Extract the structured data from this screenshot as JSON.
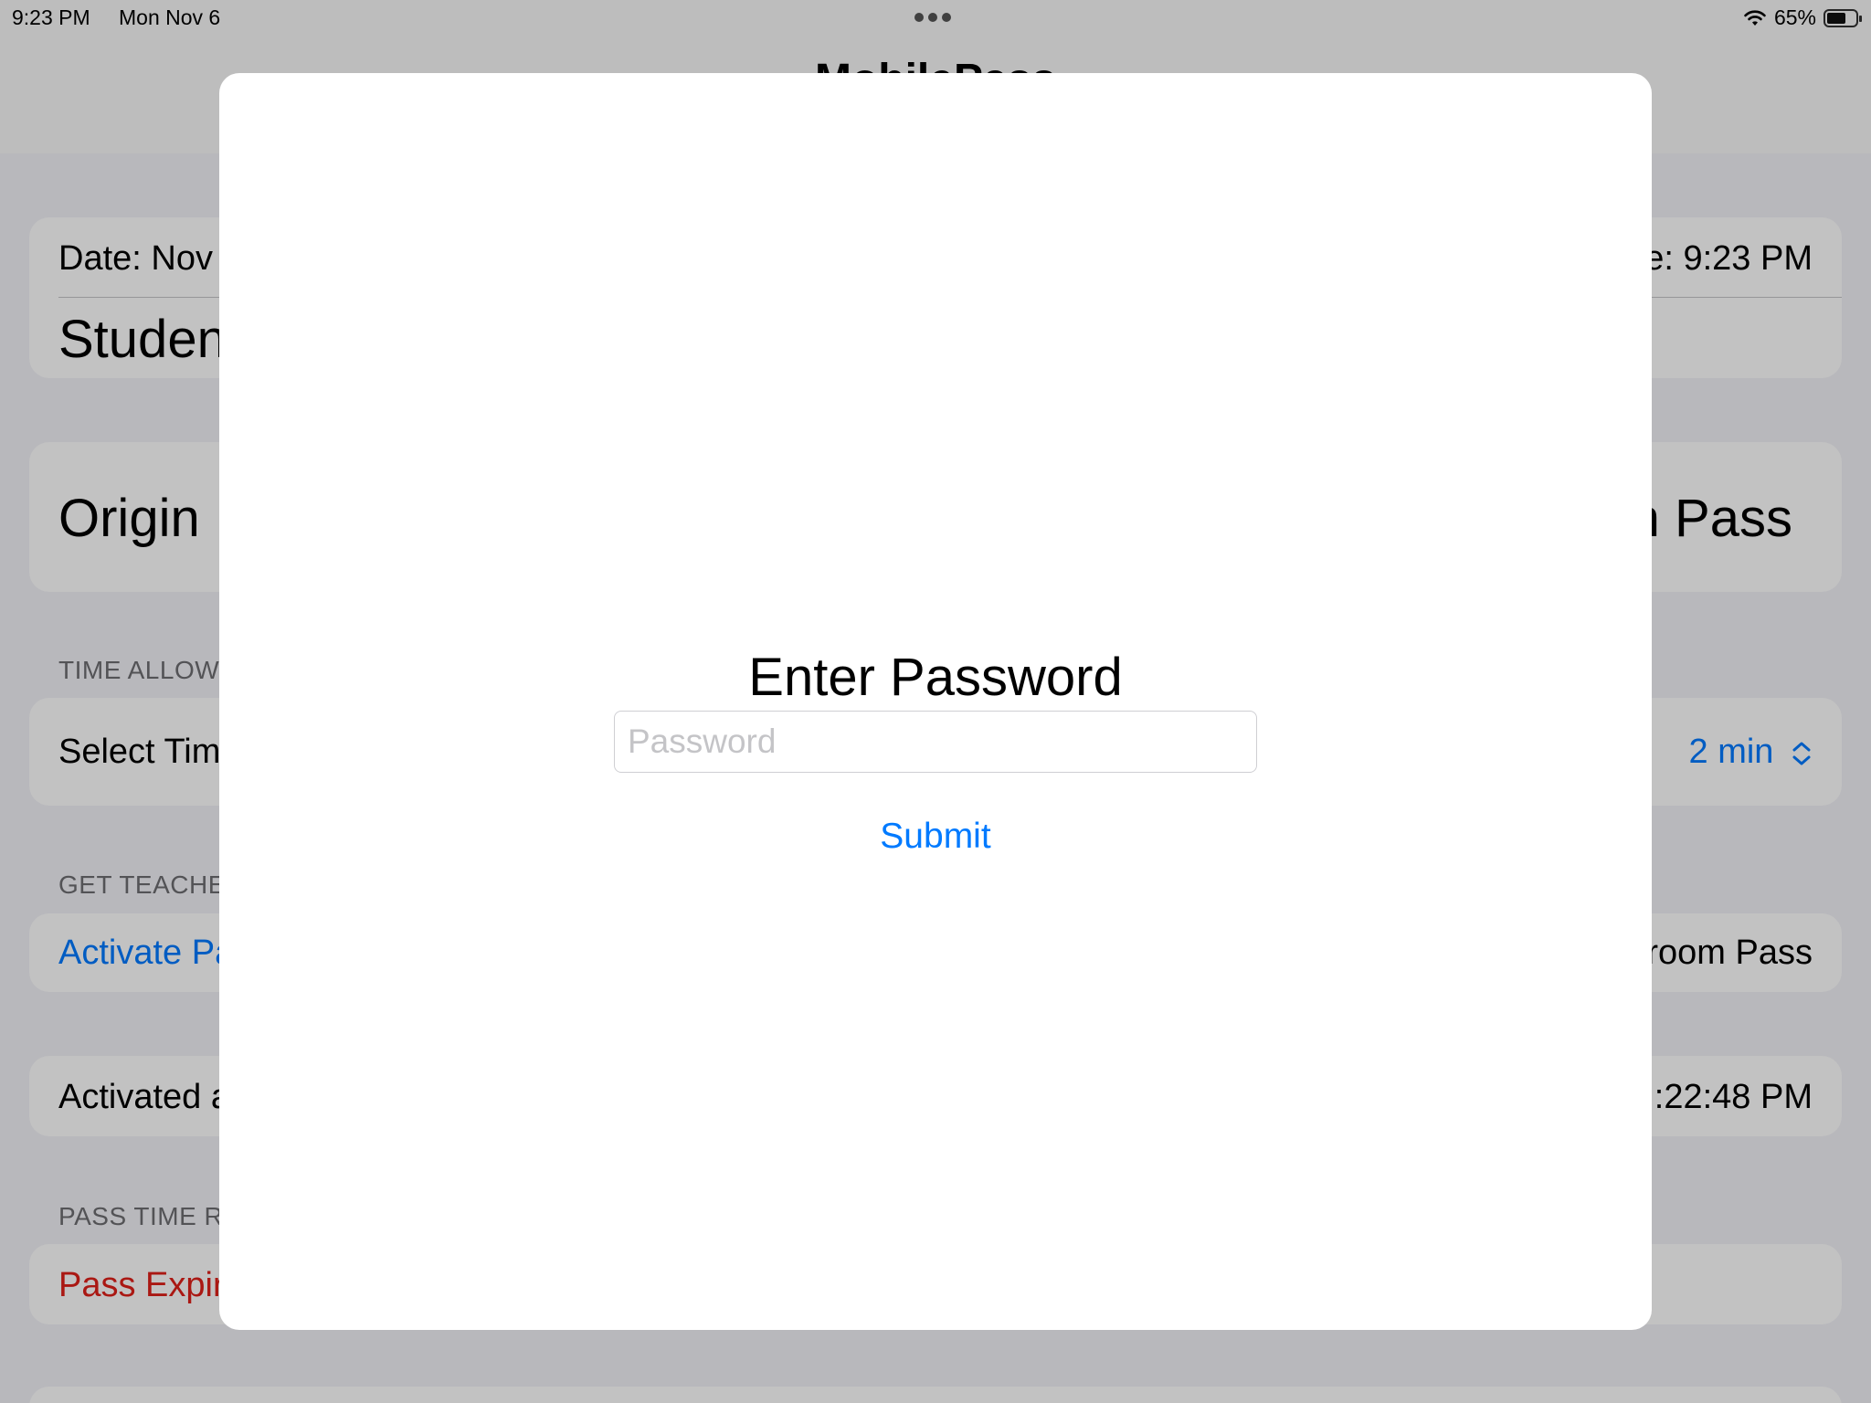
{
  "status_bar": {
    "time": "9:23 PM",
    "date": "Mon Nov 6",
    "battery": "65%",
    "battery_level": 0.65
  },
  "nav": {
    "title": "MobilePass"
  },
  "info_card": {
    "date_label": "Date: Nov",
    "time_label": "e: 9:23 PM",
    "student_label": "Studen"
  },
  "origin_card": {
    "origin_label": "Origin",
    "pass_label": "n Pass"
  },
  "time_allowed": {
    "header": "TIME ALLOW",
    "select_label": "Select Tim",
    "value": "2 min"
  },
  "teacher_section": {
    "header": "GET TEACHE",
    "activate_label": "Activate Pa",
    "pass_type": "room Pass"
  },
  "activated_card": {
    "label": "Activated a",
    "time": ":22:48 PM"
  },
  "pass_time": {
    "header": "PASS TIME R",
    "status": "Pass Expir"
  },
  "modal": {
    "title": "Enter Password",
    "password_placeholder": "Password",
    "password_value": "",
    "submit_label": "Submit"
  }
}
